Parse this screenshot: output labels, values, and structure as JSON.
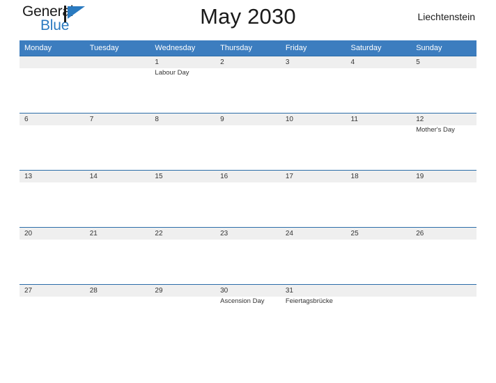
{
  "brand": {
    "name_part1": "General",
    "name_part2": "Blue",
    "mark": "triangle-flag-icon"
  },
  "header": {
    "title": "May 2030",
    "region": "Liechtenstein"
  },
  "calendar": {
    "weekday_headers": [
      "Monday",
      "Tuesday",
      "Wednesday",
      "Thursday",
      "Friday",
      "Saturday",
      "Sunday"
    ],
    "weeks": [
      [
        {
          "day": "",
          "event": ""
        },
        {
          "day": "",
          "event": ""
        },
        {
          "day": "1",
          "event": "Labour Day"
        },
        {
          "day": "2",
          "event": ""
        },
        {
          "day": "3",
          "event": ""
        },
        {
          "day": "4",
          "event": ""
        },
        {
          "day": "5",
          "event": ""
        }
      ],
      [
        {
          "day": "6",
          "event": ""
        },
        {
          "day": "7",
          "event": ""
        },
        {
          "day": "8",
          "event": ""
        },
        {
          "day": "9",
          "event": ""
        },
        {
          "day": "10",
          "event": ""
        },
        {
          "day": "11",
          "event": ""
        },
        {
          "day": "12",
          "event": "Mother's Day"
        }
      ],
      [
        {
          "day": "13",
          "event": ""
        },
        {
          "day": "14",
          "event": ""
        },
        {
          "day": "15",
          "event": ""
        },
        {
          "day": "16",
          "event": ""
        },
        {
          "day": "17",
          "event": ""
        },
        {
          "day": "18",
          "event": ""
        },
        {
          "day": "19",
          "event": ""
        }
      ],
      [
        {
          "day": "20",
          "event": ""
        },
        {
          "day": "21",
          "event": ""
        },
        {
          "day": "22",
          "event": ""
        },
        {
          "day": "23",
          "event": ""
        },
        {
          "day": "24",
          "event": ""
        },
        {
          "day": "25",
          "event": ""
        },
        {
          "day": "26",
          "event": ""
        }
      ],
      [
        {
          "day": "27",
          "event": ""
        },
        {
          "day": "28",
          "event": ""
        },
        {
          "day": "29",
          "event": ""
        },
        {
          "day": "30",
          "event": "Ascension Day"
        },
        {
          "day": "31",
          "event": "Feiertagsbrücke"
        },
        {
          "day": "",
          "event": ""
        },
        {
          "day": "",
          "event": ""
        }
      ]
    ]
  },
  "colors": {
    "header_blue": "#3c7dbf",
    "rule_blue": "#2a6ca8",
    "band_gray": "#efefef",
    "brand_blue": "#2a7ac0"
  }
}
